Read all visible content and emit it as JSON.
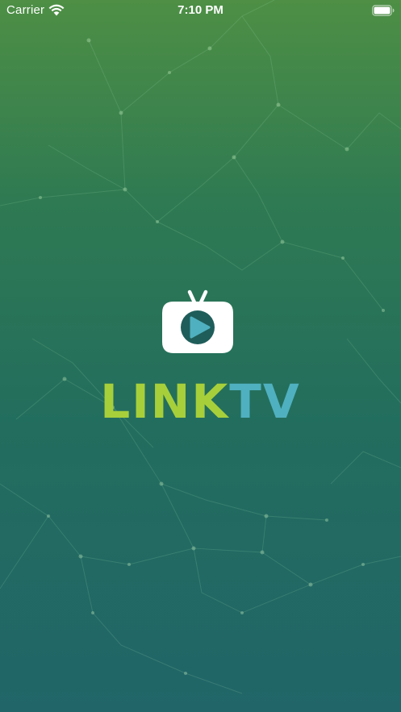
{
  "status_bar": {
    "carrier": "Carrier",
    "time": "7:10 PM"
  },
  "brand": {
    "name_part1": "LINK",
    "name_part2": "TV",
    "color_primary": "#a7cf3a",
    "color_secondary": "#4fb0bf"
  },
  "background": {
    "top_color": "#4e8f45",
    "bottom_color": "#216568"
  },
  "icons": {
    "wifi": "wifi-icon",
    "battery": "battery-icon",
    "logo": "tv-play-icon",
    "background": "network-pattern"
  }
}
